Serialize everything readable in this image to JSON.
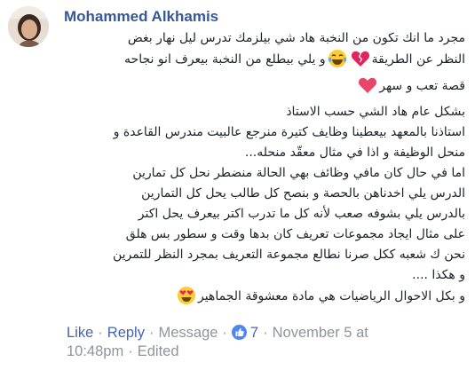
{
  "comment": {
    "author": "Mohammed Alkhamis",
    "paragraphs": [
      {
        "lines": [
          "مجرد ما انك تكون من النخبة هاد شي بيلزمك تدرس ليل نهار بغض",
          "النظر عن الطريقة|emoji:broken-heart|emoji:laughing-tears|و يلي بيطلع من النخبة بيعرف انو نجاحه",
          "قصة تعب و سهر|emoji:heart"
        ]
      },
      {
        "lines": [
          "بشكل عام هاد الشي حسب الاستاذ",
          "استاذنا بالمعهد بيعطينا وظايف كتيرة منرجع عالبيت مندرس القاعدة و",
          "منحل الوظيفة و اذا في مثال معقّد منحله..."
        ]
      },
      {
        "lines": [
          "اما في حال كان مافي وظائف بهي الحالة منضطر نحل كل تمارين",
          "الدرس يلي اخدناهن بالحصة و بنصح كل طالب يحل كل التمارين",
          "بالدرس يلي بشوفه صعب لأنه كل ما تدرب اكتر بيعرف يحل اكتر",
          "على مثال ايجاد مجموعات تعريف كان بدها وقت و سطور بس هلق",
          "نحن ك شعبه ككل صرنا نطالع مجموعة التعريف بمجرد النظر للتمرين",
          "و هكذا ...."
        ]
      },
      {
        "lines": [
          "و بكل الاحوال الرياضيات هي مادة معشوقة الجماهير|emoji:heart-eyes"
        ]
      }
    ]
  },
  "actions": {
    "like": "Like",
    "reply": "Reply",
    "message": "Message",
    "reaction_count": "7",
    "timestamp": "November 5 at 10:48pm",
    "edited": "Edited"
  },
  "icons": {
    "avatar": "avatar-photo",
    "like_badge": "thumbs-up-icon",
    "emojis": [
      "broken-heart-icon",
      "laughing-tears-icon",
      "heart-icon",
      "heart-eyes-icon"
    ]
  },
  "colors": {
    "author": "#365899",
    "link": "#4267b2",
    "meta": "#90949c",
    "text": "#1d2129",
    "like_badge": "#4e86f0"
  }
}
